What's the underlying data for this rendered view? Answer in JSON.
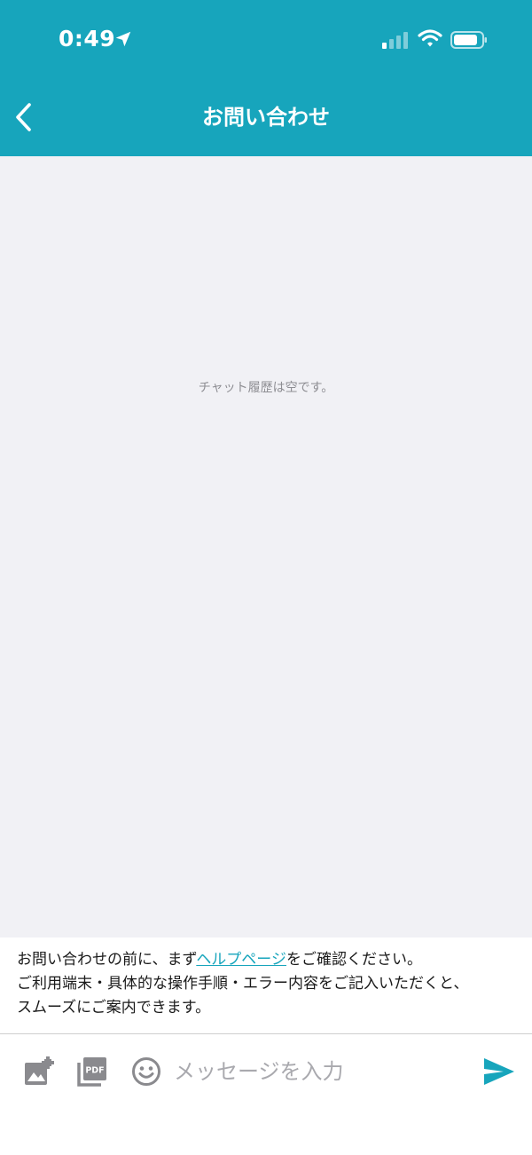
{
  "status_bar": {
    "time": "0:49",
    "icons": [
      "location-arrow-icon",
      "signal-icon",
      "wifi-icon",
      "battery-icon"
    ]
  },
  "header": {
    "title": "お問い合わせ",
    "back_icon": "chevron-left-icon"
  },
  "chat": {
    "empty_message": "チャット履歴は空です。"
  },
  "notice": {
    "line1_prefix": "お問い合わせの前に、まず",
    "help_link": "ヘルプページ",
    "line1_suffix": "をご確認ください。",
    "line2": "ご利用端末・具体的な操作手順・エラー内容をご記入いただくと、",
    "line3": "スムーズにご案内できます。"
  },
  "input_bar": {
    "placeholder": "メッセージを入力",
    "icons": [
      "image-add-icon",
      "pdf-icon",
      "emoji-icon",
      "send-icon"
    ]
  },
  "colors": {
    "brand": "#17A5BC",
    "chat_background": "#F1F1F5",
    "icon_gray": "#8A8A8E",
    "link": "#17A5BC"
  }
}
